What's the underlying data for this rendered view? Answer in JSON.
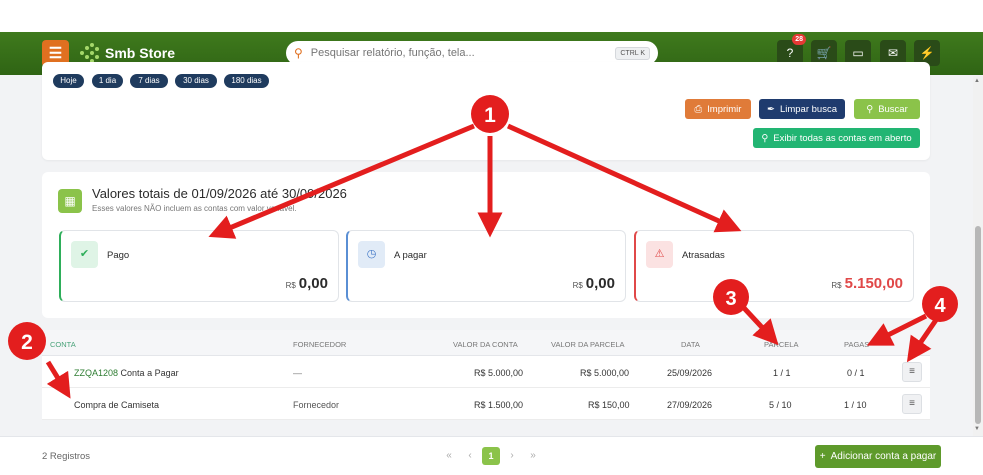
{
  "app": {
    "name": "Smb Store"
  },
  "search": {
    "placeholder": "Pesquisar relatório, função, tela...",
    "shortcut": "CTRL K"
  },
  "header": {
    "notifications_badge": "28"
  },
  "filters": {
    "ranges": [
      "Hoje",
      "1 dia",
      "7 dias",
      "30 dias",
      "180 dias"
    ],
    "print_label": "Imprimir",
    "clear_label": "Limpar busca",
    "search_label": "Buscar",
    "show_all_label": "Exibir todas as contas em aberto"
  },
  "totals": {
    "title": "Valores totais de 01/09/2026 até 30/09/2026",
    "subtitle": "Esses valores NÃO incluem as contas com valor variável.",
    "currency": "R$",
    "cards": [
      {
        "label": "Pago",
        "value": "0,00",
        "color": "#2eae5a"
      },
      {
        "label": "A pagar",
        "value": "0,00",
        "color": "#5a8fd4"
      },
      {
        "label": "Atrasadas",
        "value": "5.150,00",
        "color": "#e04848"
      }
    ]
  },
  "table": {
    "headers": [
      "CONTA",
      "FORNECEDOR",
      "VALOR DA CONTA",
      "VALOR DA PARCELA",
      "DATA",
      "PARCELA",
      "PAGAS"
    ],
    "rows": [
      {
        "code": "ZZQA1208",
        "name": "Conta a Pagar",
        "fornecedor": "—",
        "valor_conta": "R$ 5.000,00",
        "valor_parcela": "R$ 5.000,00",
        "data": "25/09/2026",
        "parcela": "1 / 1",
        "pagas": "0 / 1"
      },
      {
        "code": "",
        "name": "Compra de Camiseta",
        "fornecedor": "Fornecedor",
        "valor_conta": "R$ 1.500,00",
        "valor_parcela": "R$ 150,00",
        "data": "27/09/2026",
        "parcela": "5 / 10",
        "pagas": "1 / 10"
      }
    ]
  },
  "footer": {
    "records": "2 Registros",
    "current_page": "1",
    "add_label": "Adicionar conta a pagar"
  },
  "annotations": [
    "1",
    "2",
    "3",
    "4"
  ],
  "colors": {
    "brand_green": "#3f7a1d",
    "accent_orange": "#e07020",
    "annotation_red": "#e31e1e"
  }
}
